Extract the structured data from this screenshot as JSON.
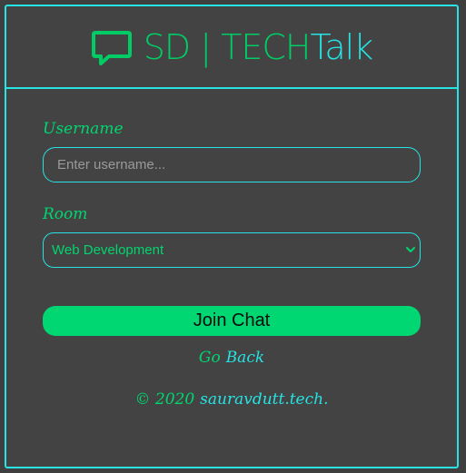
{
  "header": {
    "brand_main": "SD | TECH",
    "brand_accent": "Talk",
    "icon": "chat-bubble-icon"
  },
  "form": {
    "username_label": "Username",
    "username_placeholder": "Enter username...",
    "username_value": "",
    "room_label": "Room",
    "room_selected": "Web Development",
    "join_button": "Join Chat"
  },
  "nav": {
    "go_text": "Go",
    "back_text": "Back"
  },
  "footer": {
    "copyright": "© 2020",
    "site": "sauravdutt.tech."
  },
  "colors": {
    "background": "#434343",
    "accent_cyan": "#27e3e3",
    "accent_green": "#00d66f",
    "button_green": "#00d672"
  }
}
